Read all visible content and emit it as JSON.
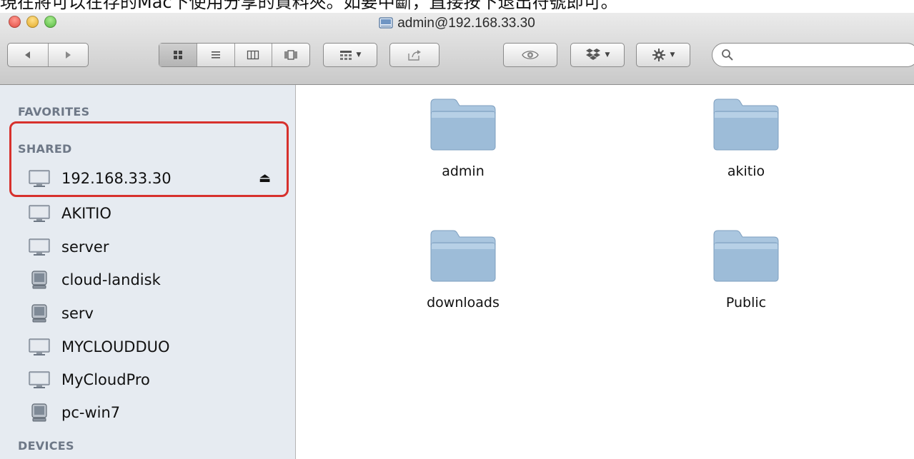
{
  "caption": "現在將可以在存的Mac下使用分享的資料夾。如要中斷，直接按下退出符號即可。",
  "window": {
    "title": "admin@192.168.33.30"
  },
  "toolbar": {
    "search_placeholder": ""
  },
  "sidebar": {
    "sections": {
      "favorites": "FAVORITES",
      "shared": "SHARED",
      "devices": "DEVICES"
    },
    "shared_items": [
      {
        "label": "192.168.33.30",
        "icon": "display-icon"
      },
      {
        "label": "AKITIO",
        "icon": "display-icon"
      },
      {
        "label": "server",
        "icon": "display-icon"
      },
      {
        "label": "cloud-landisk",
        "icon": "pc-monitor-icon"
      },
      {
        "label": "serv",
        "icon": "pc-monitor-icon"
      },
      {
        "label": "MYCLOUDDUO",
        "icon": "display-icon"
      },
      {
        "label": "MyCloudPro",
        "icon": "display-icon"
      },
      {
        "label": "pc-win7",
        "icon": "pc-monitor-icon"
      }
    ]
  },
  "content": {
    "folders": [
      {
        "label": "admin"
      },
      {
        "label": "akitio"
      },
      {
        "label": "downloads"
      },
      {
        "label": "Public"
      }
    ]
  },
  "colors": {
    "highlight": "#d7312d",
    "sidebar_bg": "#e6ebf1",
    "folder": "#9bbbd6"
  }
}
